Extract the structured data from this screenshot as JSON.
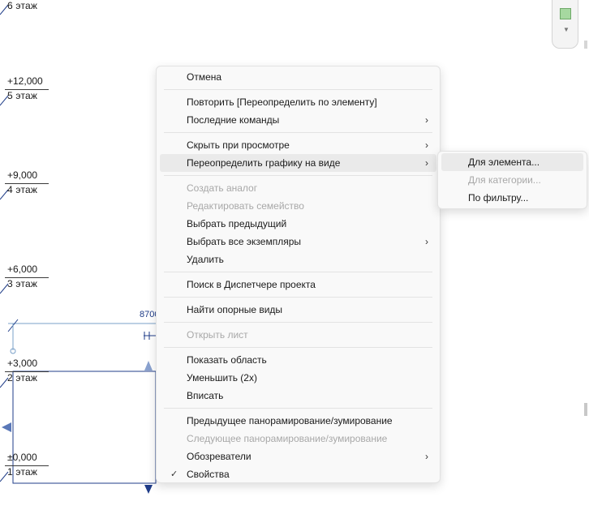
{
  "levels": [
    {
      "elevation": "",
      "name": "6 этаж"
    },
    {
      "elevation": "+12,000",
      "name": "5 этаж"
    },
    {
      "elevation": "+9,000",
      "name": "4 этаж"
    },
    {
      "elevation": "+6,000",
      "name": "3 этаж"
    },
    {
      "elevation": "+3,000",
      "name": "2 этаж"
    },
    {
      "elevation": "±0,000",
      "name": "1 этаж"
    }
  ],
  "dimension_label": "8700",
  "context_menu": {
    "items": {
      "cancel": "Отмена",
      "repeat": "Повторить [Переопределить по элементу]",
      "recent": "Последние команды",
      "hide": "Скрыть при просмотре",
      "override": "Переопределить графику на виде",
      "create_similar": "Создать аналог",
      "edit_family": "Редактировать семейство",
      "select_previous": "Выбрать предыдущий",
      "select_all": "Выбрать все экземпляры",
      "delete": "Удалить",
      "find_browser": "Поиск в Диспетчере проекта",
      "find_views": "Найти опорные виды",
      "open_sheet": "Открыть лист",
      "zoom_region": "Показать область",
      "zoom_out": "Уменьшить (2x)",
      "zoom_fit": "Вписать",
      "prev_pan": "Предыдущее панорамирование/зумирование",
      "next_pan": "Следующее панорамирование/зумирование",
      "browsers": "Обозреватели",
      "properties": "Свойства"
    },
    "submenu": {
      "by_element": "Для элемента...",
      "by_category": "Для категории...",
      "by_filter": "По фильтру..."
    },
    "arrow": "›",
    "check": "✓"
  }
}
